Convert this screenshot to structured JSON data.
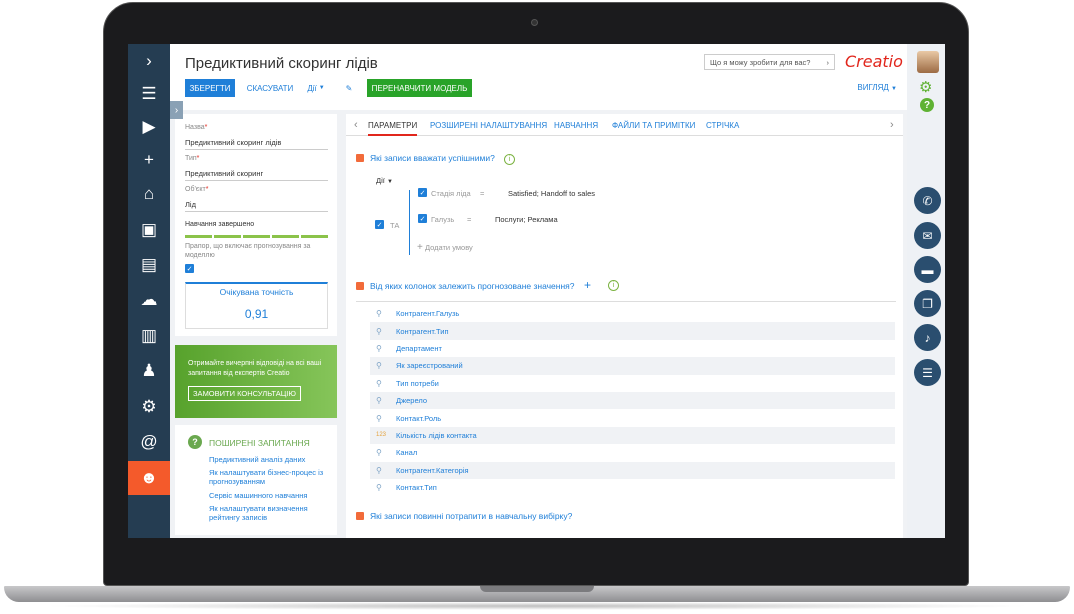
{
  "page": {
    "title": "Предиктивний скоринг лідів",
    "search_placeholder": "Що я можу зробити для вас?",
    "logo": "Creatio"
  },
  "toolbar": {
    "save": "ЗБЕРЕГТИ",
    "cancel": "СКАСУВАТИ",
    "actions": "Дії",
    "retrain": "ПЕРЕНАВЧИТИ МОДЕЛЬ",
    "view": "ВИГЛЯД"
  },
  "form": {
    "name_label": "Назва",
    "name_value": "Предиктивний скоринг лідів",
    "type_label": "Тип",
    "type_value": "Предиктивний скоринг",
    "object_label": "Об'єкт",
    "object_value": "Лід",
    "training_label": "Навчання завершено",
    "progress": 1.0,
    "flag_label": "Прапор, що включає прогнозування за моделлю",
    "flag_checked": true,
    "accuracy_label": "Очікувана точність",
    "accuracy_value": "0,91"
  },
  "promo": {
    "text": "Отримайте вичерпні відповіді на всі ваші запитання від експертів Creatio",
    "button": "ЗАМОВИТИ КОНСУЛЬТАЦІЮ"
  },
  "faq": {
    "title": "ПОШИРЕНІ ЗАПИТАННЯ",
    "links": [
      "Предиктивний аналіз даних",
      "Як налаштувати бізнес-процес із прогнозуванням",
      "Сервіс машинного навчання",
      "Як налаштувати визначення рейтингу записів"
    ]
  },
  "tabs": [
    "ПАРАМЕТРИ",
    "РОЗШИРЕНІ НАЛАШТУВАННЯ",
    "НАВЧАННЯ",
    "ФАЙЛИ ТА ПРИМІТКИ",
    "СТРІЧКА"
  ],
  "section1": {
    "title": "Які записи вважати успішними?",
    "actions": "Дії",
    "group_op": "ТА",
    "conditions": [
      {
        "field": "Стадія ліда",
        "op": "=",
        "value": "Satisfied; Handoff to sales"
      },
      {
        "field": "Галузь",
        "op": "=",
        "value": "Послуги; Реклама"
      }
    ],
    "add_condition": "Додати умову"
  },
  "section2": {
    "title": "Від яких колонок залежить прогнозоване значення?",
    "columns": [
      {
        "name": "Контрагент.Галузь",
        "icon": "lookup-icon"
      },
      {
        "name": "Контрагент.Тип",
        "icon": "lookup-icon"
      },
      {
        "name": "Департамент",
        "icon": "lookup-icon"
      },
      {
        "name": "Як зареєстрований",
        "icon": "lookup-icon"
      },
      {
        "name": "Тип потреби",
        "icon": "lookup-icon"
      },
      {
        "name": "Джерело",
        "icon": "lookup-icon"
      },
      {
        "name": "Контакт.Роль",
        "icon": "lookup-icon"
      },
      {
        "name": "Кількість лідів контакта",
        "icon": "number-icon",
        "icon_text": "123"
      },
      {
        "name": "Канал",
        "icon": "lookup-icon"
      },
      {
        "name": "Контрагент.Категорія",
        "icon": "lookup-icon"
      },
      {
        "name": "Контакт.Тип",
        "icon": "lookup-icon"
      }
    ]
  },
  "section3": {
    "title": "Які записи повинні потрапити в навчальну вибірку?"
  },
  "colors": {
    "nav_bg": "#253d52",
    "accent_blue": "#1f7fd8",
    "accent_green": "#29a329",
    "active_nav": "#f45a2b"
  }
}
